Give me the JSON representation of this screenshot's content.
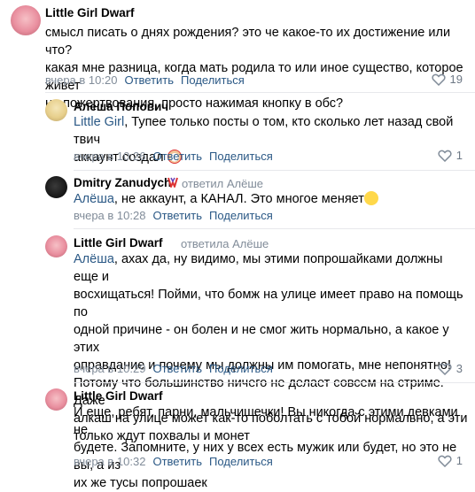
{
  "comments": [
    {
      "author": "Little Girl Dwarf",
      "reply_to": "",
      "text_lines": [
        "смысл писать о днях рождения? это че какое-то их достижение или что?",
        "какая мне разница, когда мать родила то или иное существо, которое живет",
        "на пожертвования, просто нажимая кнопку в обс?"
      ],
      "time": "вчера в 10:20",
      "reply_label": "Ответить",
      "share_label": "Поделиться",
      "likes": "19"
    },
    {
      "author": "Алёша Попович",
      "reply_to": "",
      "mention": "Little Girl",
      "text_lines": [
        ", Тупее только посты о том, кто сколько лет назад свой твич",
        "аккаунт создал"
      ],
      "time": "вчера в 10:26",
      "reply_label": "Ответить",
      "share_label": "Поделиться",
      "likes": "1"
    },
    {
      "author": "Dmitry Zanudych",
      "reply_to": "ответил Алёше",
      "mention": "Алёша",
      "text_lines": [
        ", не аккаунт, а КАНАЛ. Это многое меняет"
      ],
      "time": "вчера в 10:28",
      "reply_label": "Ответить",
      "share_label": "Поделиться",
      "likes": ""
    },
    {
      "author": "Little Girl Dwarf",
      "reply_to": "ответила Алёше",
      "mention": "Алёша",
      "text_lines": [
        ", ахах да, ну видимо, мы этими попрошайками должны еще и",
        "восхищаться! Пойми, что бомж на улице имеет право на помощь по",
        "одной причине - он болен и не смог жить нормально, а какое у этих",
        "оправдание и почему мы должны им помогать, мне непонятно!",
        "Потому что большинство ничего не делает совсем на стриме. Даже",
        "алкаш на улице может как-то поболтать с тобой нормально, а эти",
        "только ждут похвалы и монет"
      ],
      "time": "вчера в 10:29",
      "reply_label": "Ответить",
      "share_label": "Поделиться",
      "likes": "3"
    },
    {
      "author": "Little Girl Dwarf",
      "reply_to": "",
      "text_lines": [
        "И еще, ребят, парни, мальчишечки! Вы никогда с этими девками не",
        "будете. Запомните, у них у всех есть мужик или будет, но это не вы, а из",
        "их же тусы попрошаек"
      ],
      "time": "вчера в 10:32",
      "reply_label": "Ответить",
      "share_label": "Поделиться",
      "likes": "1"
    }
  ],
  "icons": {
    "like": "heart-icon",
    "clown": "clown-emoji",
    "eyeroll": "rolling-eyes-emoji",
    "badge": "vk-badge-icon"
  },
  "colors": {
    "link": "#2a5885",
    "meta": "#818c99",
    "divider": "#e7e8ec"
  }
}
